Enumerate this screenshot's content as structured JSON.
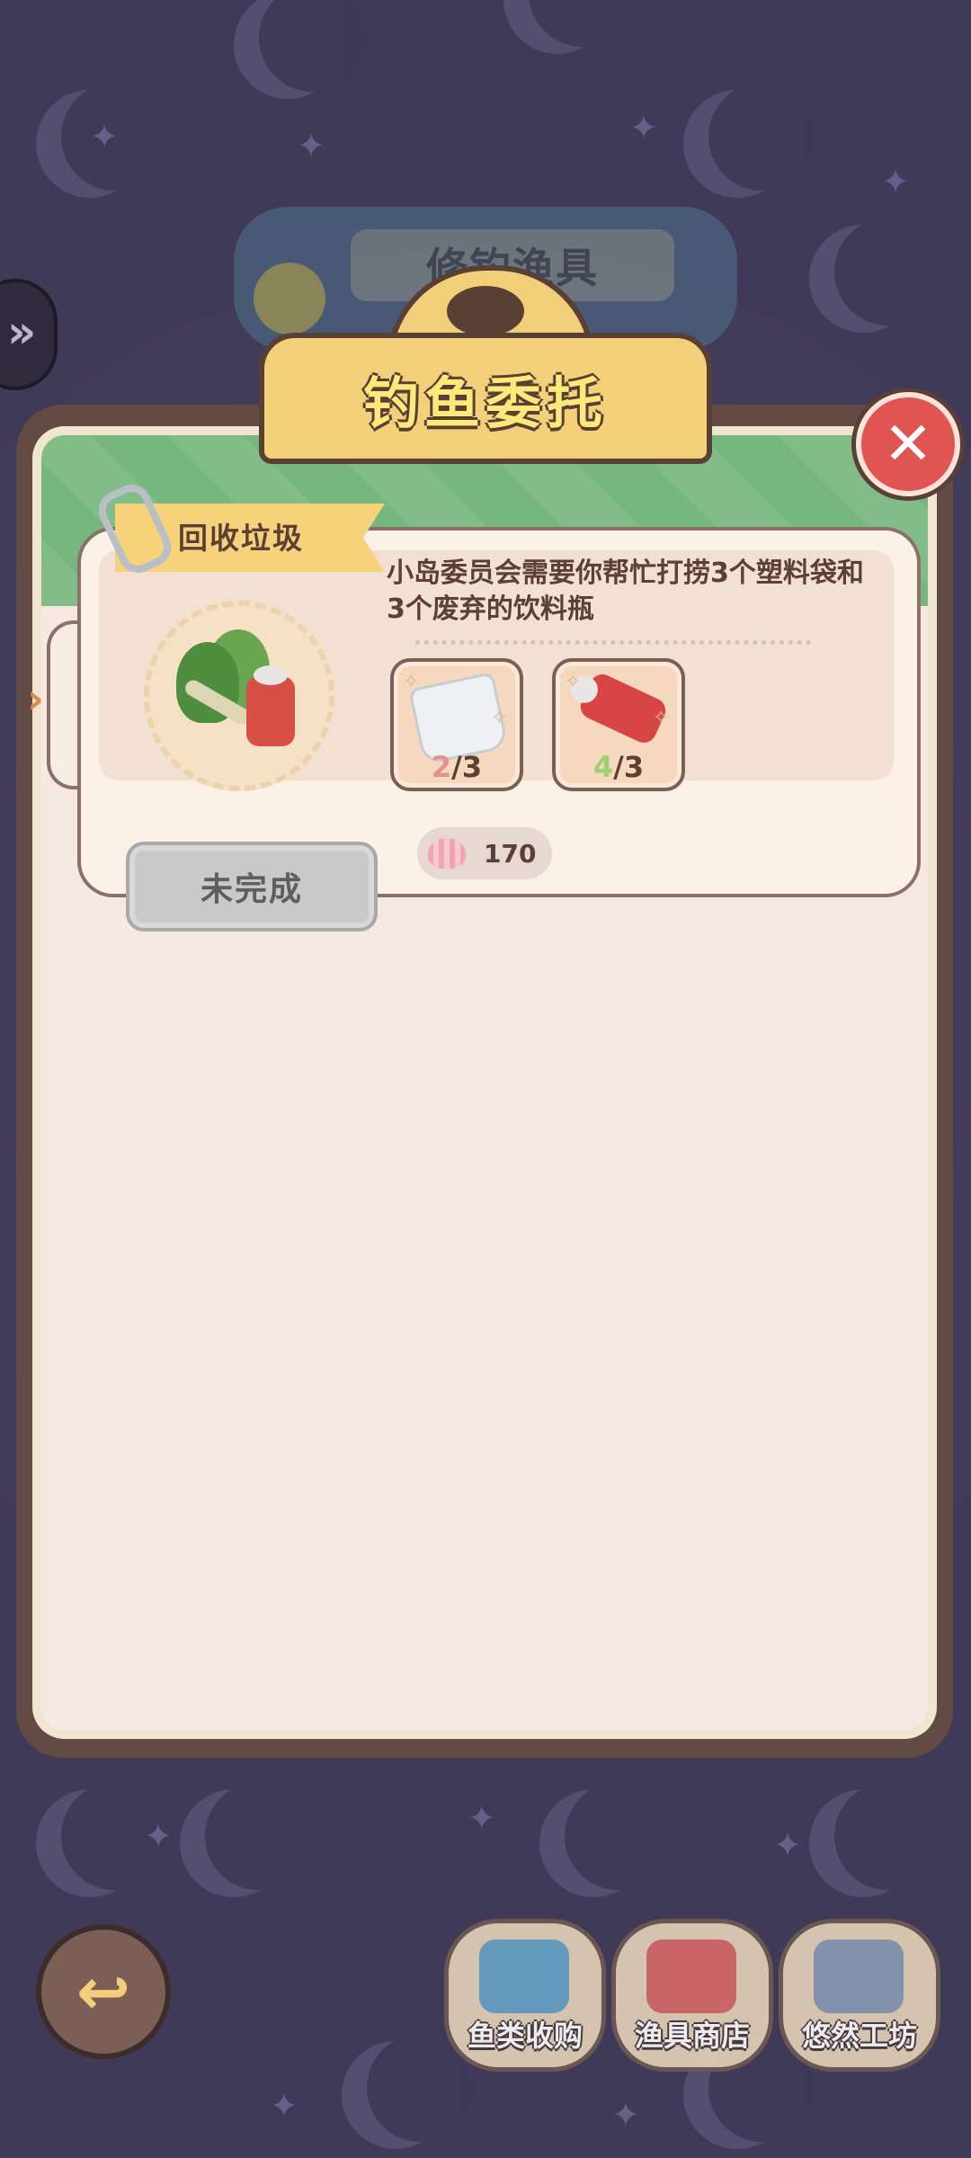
{
  "background": {
    "banner_title": "修钓渔具"
  },
  "dialog": {
    "title": "钓鱼委托",
    "close_icon": "close-x-icon"
  },
  "quest": {
    "tag": "回收垃圾",
    "description": "小岛委员会需要你帮忙打捞3个塑料袋和3个废弃的饮料瓶",
    "items": [
      {
        "name": "plastic-bag",
        "current": "2",
        "required": "3"
      },
      {
        "name": "drink-bottle",
        "current": "4",
        "required": "3"
      }
    ],
    "reward_value": "170",
    "status": "未完成"
  },
  "bottom_nav": {
    "back_icon": "back-arrow-icon",
    "items": [
      {
        "label": "鱼类收购"
      },
      {
        "label": "渔具商店"
      },
      {
        "label": "悠然工坊"
      }
    ]
  },
  "colors": {
    "background": "#3f3a58",
    "dialog_border": "#634a45",
    "header_green": "#76b77d",
    "plaque_gold": "#f3d17b",
    "close_red": "#e05451",
    "status_gray": "#c9c9c9"
  }
}
